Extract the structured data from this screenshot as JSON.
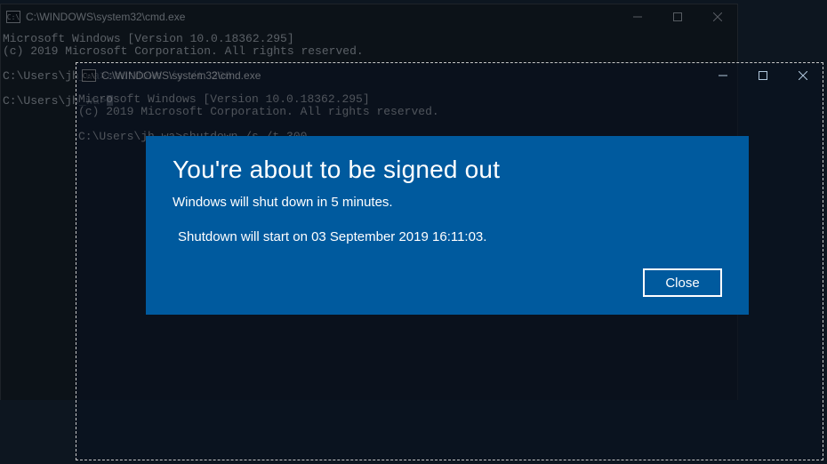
{
  "cmd1": {
    "title": "C:\\WINDOWS\\system32\\cmd.exe",
    "line_version": "Microsoft Windows [Version 10.0.18362.295]",
    "line_copyright": "(c) 2019 Microsoft Corporation. All rights reserved.",
    "line_cmd1": "C:\\Users\\jh_wa>shutdown /s /t 300",
    "line_prompt": "C:\\Users\\jh_wa>"
  },
  "cmd2": {
    "title": "C:\\WINDOWS\\system32\\cmd.exe",
    "line_version": "Microsoft Windows [Version 10.0.18362.295]",
    "line_copyright": "(c) 2019 Microsoft Corporation. All rights reserved.",
    "line_cmd1": "C:\\Users\\jh_wa>shutdown /s /t 300"
  },
  "dialog": {
    "title": "You're about to be signed out",
    "line1": "Windows will shut down in 5 minutes.",
    "line2": "Shutdown will start on 03 September 2019 16:11:03.",
    "close_label": "Close"
  }
}
